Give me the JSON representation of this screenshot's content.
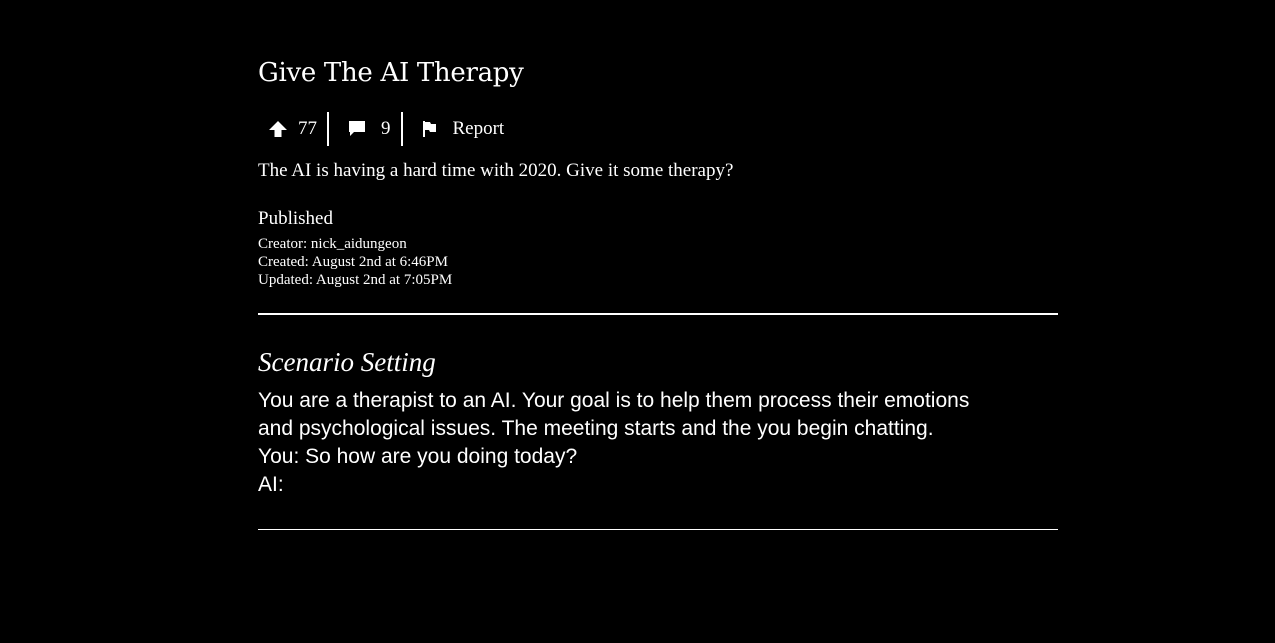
{
  "scenario": {
    "title": "Give The AI Therapy",
    "description": "The AI is having a hard time with 2020. Give it some therapy?",
    "status": "Published",
    "creator": "Creator: nick_aidungeon",
    "created": "Created: August 2nd at 6:46PM",
    "updated": "Updated: August 2nd at 7:05PM"
  },
  "actions": {
    "upvote_count": "77",
    "comment_count": "9",
    "report_label": "Report"
  },
  "setting": {
    "heading": "Scenario Setting",
    "lines": [
      "You are a therapist to an AI. Your goal is to help them process their emotions",
      "and psychological issues. The meeting starts and the you begin chatting.",
      "You: So how are you doing today?",
      "AI:"
    ]
  },
  "icons": {
    "upvote": "arrow-up-icon",
    "comments": "comment-icon",
    "report": "flag-icon"
  },
  "colors": {
    "background": "#000000",
    "text": "#ffffff"
  }
}
